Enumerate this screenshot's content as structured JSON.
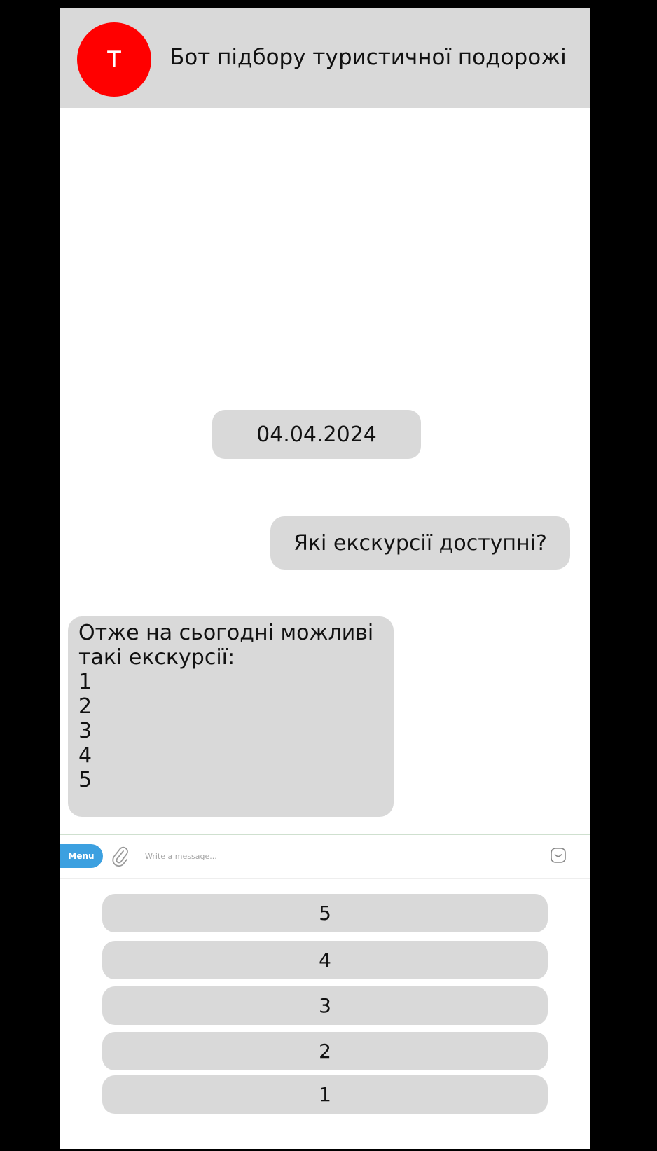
{
  "header": {
    "avatar_letter": "T",
    "avatar_color": "#ff0000",
    "title": "Бот підбору туристичної подорожі"
  },
  "chat": {
    "date": "04.04.2024",
    "outgoing_message": "Які екскурсії доступні?",
    "incoming_message_lines": [
      "Отже на сьогодні можливі",
      "такі екскурсії:",
      "1",
      "2",
      "3",
      "4",
      "5"
    ]
  },
  "composer": {
    "menu_label": "Menu",
    "placeholder": "Write a message...",
    "menu_color": "#3ca0e0",
    "attach_icon": "paperclip-icon",
    "emoji_icon": "emoji-icon"
  },
  "keyboard": {
    "buttons": [
      "5",
      "4",
      "3",
      "2",
      "1"
    ]
  }
}
